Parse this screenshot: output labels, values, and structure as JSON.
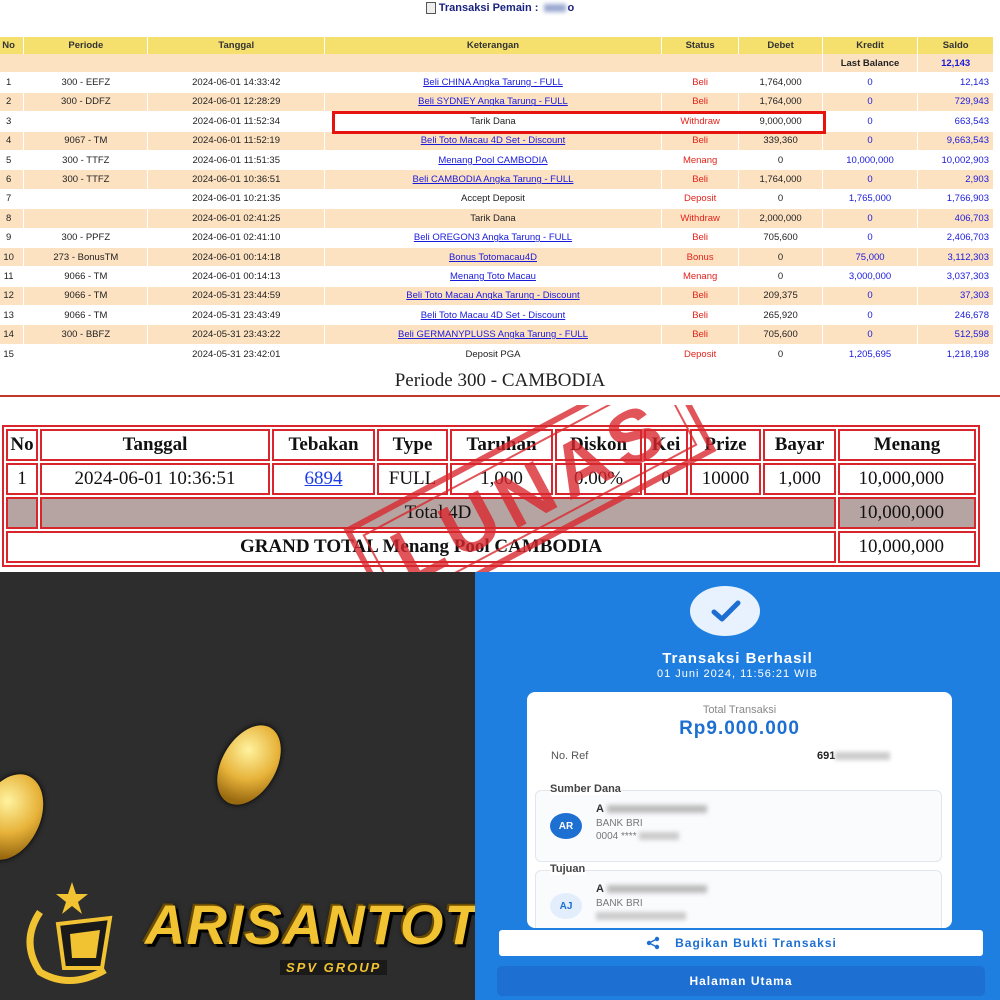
{
  "transaction_header": {
    "title": "Transaksi  Pemain :",
    "player_suffix": "o"
  },
  "transactions": {
    "columns": [
      "No",
      "Periode",
      "Tanggal",
      "Keterangan",
      "Status",
      "Debet",
      "Kredit",
      "Saldo"
    ],
    "last_balance_label": "Last Balance",
    "last_balance_value": "12,143",
    "rows": [
      {
        "no": "1",
        "periode": "300 - EEFZ",
        "tanggal": "2024-06-01 14:33:42",
        "keterangan": "Beli CHINA Angka Tarung - FULL",
        "status": "Beli",
        "debet": "1,764,000",
        "kredit": "0",
        "saldo": "12,143"
      },
      {
        "no": "2",
        "periode": "300 - DDFZ",
        "tanggal": "2024-06-01 12:28:29",
        "keterangan": "Beli SYDNEY Angka Tarung - FULL",
        "status": "Beli",
        "debet": "1,764,000",
        "kredit": "0",
        "saldo": "729,943"
      },
      {
        "no": "3",
        "periode": "",
        "tanggal": "2024-06-01 11:52:34",
        "keterangan": "Tarik Dana",
        "status": "Withdraw",
        "debet": "9,000,000",
        "kredit": "0",
        "saldo": "663,543"
      },
      {
        "no": "4",
        "periode": "9067 - TM",
        "tanggal": "2024-06-01 11:52:19",
        "keterangan": "Beli Toto Macau 4D Set - Discount",
        "status": "Beli",
        "debet": "339,360",
        "kredit": "0",
        "saldo": "9,663,543"
      },
      {
        "no": "5",
        "periode": "300 - TTFZ",
        "tanggal": "2024-06-01 11:51:35",
        "keterangan": "Menang Pool CAMBODIA",
        "status": "Menang",
        "debet": "0",
        "kredit": "10,000,000",
        "saldo": "10,002,903"
      },
      {
        "no": "6",
        "periode": "300 - TTFZ",
        "tanggal": "2024-06-01 10:36:51",
        "keterangan": "Beli CAMBODIA Angka Tarung - FULL",
        "status": "Beli",
        "debet": "1,764,000",
        "kredit": "0",
        "saldo": "2,903"
      },
      {
        "no": "7",
        "periode": "",
        "tanggal": "2024-06-01 10:21:35",
        "keterangan": "Accept Deposit",
        "status": "Deposit",
        "debet": "0",
        "kredit": "1,765,000",
        "saldo": "1,766,903"
      },
      {
        "no": "8",
        "periode": "",
        "tanggal": "2024-06-01 02:41:25",
        "keterangan": "Tarik Dana",
        "status": "Withdraw",
        "debet": "2,000,000",
        "kredit": "0",
        "saldo": "406,703"
      },
      {
        "no": "9",
        "periode": "300 - PPFZ",
        "tanggal": "2024-06-01 02:41:10",
        "keterangan": "Beli OREGON3 Angka Tarung - FULL",
        "status": "Beli",
        "debet": "705,600",
        "kredit": "0",
        "saldo": "2,406,703"
      },
      {
        "no": "10",
        "periode": "273 - BonusTM",
        "tanggal": "2024-06-01 00:14:18",
        "keterangan": "Bonus Totomacau4D",
        "status": "Bonus",
        "debet": "0",
        "kredit": "75,000",
        "saldo": "3,112,303"
      },
      {
        "no": "11",
        "periode": "9066 - TM",
        "tanggal": "2024-06-01 00:14:13",
        "keterangan": "Menang Toto Macau",
        "status": "Menang",
        "debet": "0",
        "kredit": "3,000,000",
        "saldo": "3,037,303"
      },
      {
        "no": "12",
        "periode": "9066 - TM",
        "tanggal": "2024-05-31 23:44:59",
        "keterangan": "Beli Toto Macau Angka Tarung - Discount",
        "status": "Beli",
        "debet": "209,375",
        "kredit": "0",
        "saldo": "37,303"
      },
      {
        "no": "13",
        "periode": "9066 - TM",
        "tanggal": "2024-05-31 23:43:49",
        "keterangan": "Beli Toto Macau 4D Set - Discount",
        "status": "Beli",
        "debet": "265,920",
        "kredit": "0",
        "saldo": "246,678"
      },
      {
        "no": "14",
        "periode": "300 - BBFZ",
        "tanggal": "2024-05-31 23:43:22",
        "keterangan": "Beli GERMANYPLUSS Angka Tarung - FULL",
        "status": "Beli",
        "debet": "705,600",
        "kredit": "0",
        "saldo": "512,598"
      },
      {
        "no": "15",
        "periode": "",
        "tanggal": "2024-05-31 23:42:01",
        "keterangan": "Deposit PGA",
        "status": "Deposit",
        "debet": "0",
        "kredit": "1,205,695",
        "saldo": "1,218,198"
      }
    ]
  },
  "periode": {
    "title": "Periode 300 - CAMBODIA",
    "columns": [
      "No",
      "Tanggal",
      "Tebakan",
      "Type",
      "Taruhan",
      "Diskon",
      "Kei",
      "Prize",
      "Bayar",
      "Menang"
    ],
    "row": {
      "no": "1",
      "tanggal": "2024-06-01 10:36:51",
      "tebakan": "6894",
      "type": "FULL",
      "taruhan": "1,000",
      "diskon": "0.00%",
      "kei": "0",
      "prize": "10000",
      "bayar": "1,000",
      "menang": "10,000,000"
    },
    "total_label": "Total 4D",
    "total_value": "10,000,000",
    "grand_label": "GRAND TOTAL  Menang Pool CAMBODIA",
    "grand_value": "10,000,000",
    "stamp_text": "LUNAS"
  },
  "brand": {
    "name": "ARISANTOTO",
    "sub": "SPV GROUP"
  },
  "receipt": {
    "status": "Transaksi Berhasil",
    "datetime": "01 Juni 2024, 11:56:21 WIB",
    "total_label": "Total Transaksi",
    "amount": "Rp9.000.000",
    "ref_label": "No. Ref",
    "ref_prefix": "691",
    "source_label": "Sumber Dana",
    "source_initials": "AR",
    "source_name_initial": "A",
    "source_bank": "BANK BRI",
    "source_account_prefix": "0004 **** ",
    "dest_label": "Tujuan",
    "dest_initials": "AJ",
    "dest_name_initial": "A",
    "dest_bank": "BANK BRI",
    "share_label": "Bagikan Bukti Transaksi",
    "home_label": "Halaman Utama"
  }
}
